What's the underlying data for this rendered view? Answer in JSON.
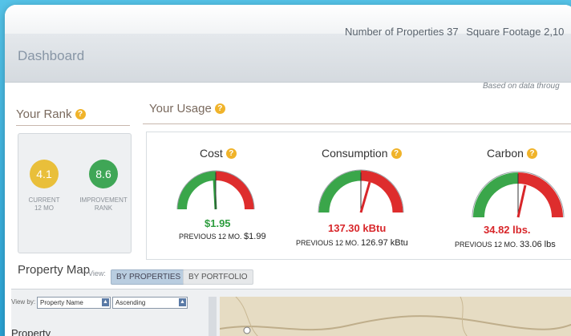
{
  "header": {
    "title": "Dashboard",
    "properties_label": "Number of Properties 37",
    "sqft_label": "Square Footage 2,10",
    "based_on": "Based on data throug"
  },
  "rank": {
    "heading": "Your Rank",
    "current_value": "4.1",
    "current_label_1": "CURRENT",
    "current_label_2": "12 MO",
    "improvement_value": "8.6",
    "improvement_label_1": "IMPROVEMENT",
    "improvement_label_2": "RANK",
    "current_color": "#e9bf3a",
    "improvement_color": "#3fa656"
  },
  "usage": {
    "heading": "Your Usage",
    "gauges": [
      {
        "title": "Cost",
        "value": "$1.95",
        "value_color": "#2e9d3f",
        "prev_label": "PREVIOUS 12 MO.",
        "prev_value": "$1.99"
      },
      {
        "title": "Consumption",
        "value": "137.30 kBtu",
        "value_color": "#d8262a",
        "prev_label": "PREVIOUS 12 MO.",
        "prev_value": "126.97 kBtu"
      },
      {
        "title": "Carbon",
        "value": "34.82 lbs.",
        "value_color": "#d8262a",
        "prev_label": "PREVIOUS 12 MO.",
        "prev_value": "33.06 lbs"
      }
    ]
  },
  "map": {
    "heading": "Property Map",
    "view_label": "View:",
    "btn_properties": "BY PROPERTIES",
    "btn_portfolio": "BY PORTFOLIO",
    "view_by_label": "View by:",
    "sort_field": "Property Name",
    "sort_order": "Ascending",
    "list_heading": "Property"
  }
}
